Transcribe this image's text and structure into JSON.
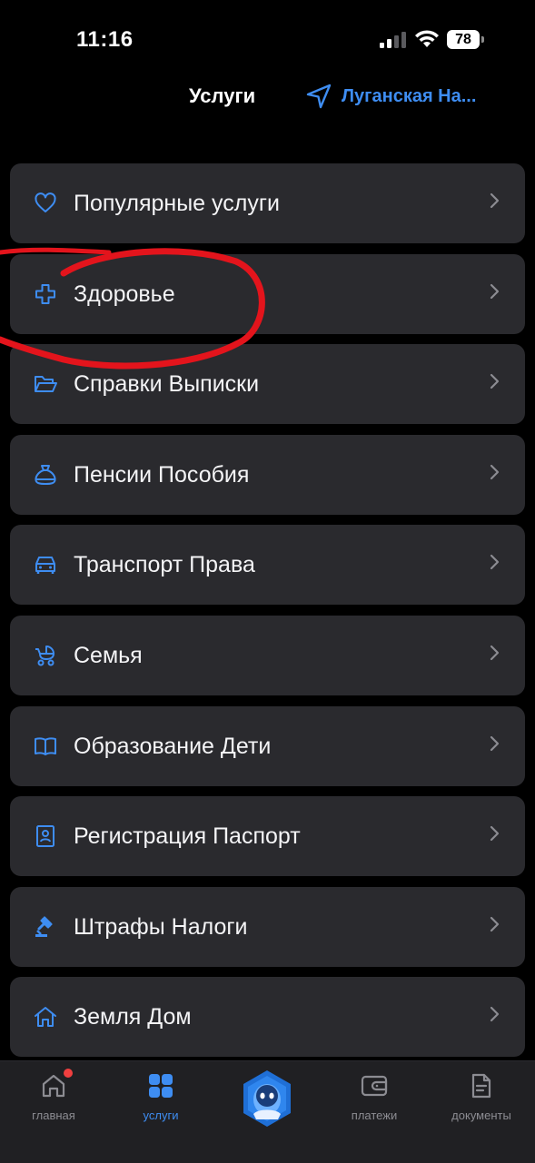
{
  "status_bar": {
    "time": "11:16",
    "battery": "78"
  },
  "header": {
    "title": "Услуги",
    "location": "Луганская На..."
  },
  "services": [
    {
      "label": "Популярные услуги",
      "icon": "heart-icon"
    },
    {
      "label": "Здоровье",
      "icon": "medical-cross-icon"
    },
    {
      "label": "Справки Выписки",
      "icon": "folder-icon"
    },
    {
      "label": "Пенсии Пособия",
      "icon": "money-bag-icon"
    },
    {
      "label": "Транспорт Права",
      "icon": "car-icon"
    },
    {
      "label": "Семья",
      "icon": "stroller-icon"
    },
    {
      "label": "Образование Дети",
      "icon": "book-icon"
    },
    {
      "label": "Регистрация Паспорт",
      "icon": "id-card-icon"
    },
    {
      "label": "Штрафы Налоги",
      "icon": "gavel-icon"
    },
    {
      "label": "Земля Дом",
      "icon": "house-icon"
    }
  ],
  "tabbar": {
    "home": "главная",
    "services": "услуги",
    "payments": "платежи",
    "documents": "документы"
  },
  "colors": {
    "accent": "#3e8df2",
    "card": "#2a2a2e",
    "background": "#000000",
    "annotation": "#e3141c"
  }
}
